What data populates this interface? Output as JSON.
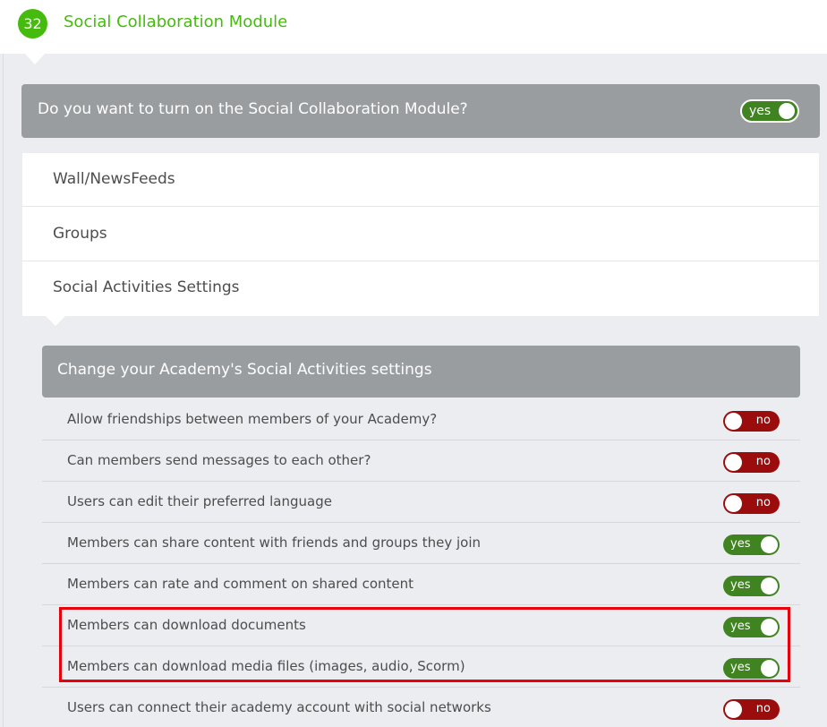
{
  "colors": {
    "accent_green": "#45bb0d",
    "toggle_on": "#3f8421",
    "toggle_off": "#9b0d0d",
    "header_bar_gray": "#9a9da0",
    "highlight_red": "#e8000b"
  },
  "header": {
    "step_number": "32",
    "title": "Social Collaboration Module"
  },
  "question": {
    "text": "Do you want to turn on the Social Collaboration Module?",
    "toggle_label": "yes",
    "toggle_state": "on"
  },
  "tabs": [
    {
      "label": "Wall/NewsFeeds"
    },
    {
      "label": "Groups"
    },
    {
      "label": "Social Activities Settings"
    }
  ],
  "settings": {
    "header": "Change your Academy's Social Activities settings",
    "items": [
      {
        "label": "Allow friendships between members of your Academy?",
        "toggle_label": "no",
        "state": "off"
      },
      {
        "label": "Can members send messages to each other?",
        "toggle_label": "no",
        "state": "off"
      },
      {
        "label": "Users can edit their preferred language",
        "toggle_label": "no",
        "state": "off"
      },
      {
        "label": "Members can share content with friends and groups they join",
        "toggle_label": "yes",
        "state": "on"
      },
      {
        "label": "Members can rate and comment on shared content",
        "toggle_label": "yes",
        "state": "on"
      },
      {
        "label": "Members can download documents",
        "toggle_label": "yes",
        "state": "on"
      },
      {
        "label": "Members can download media files (images, audio, Scorm)",
        "toggle_label": "yes",
        "state": "on"
      },
      {
        "label": "Users can connect their academy account with social networks",
        "toggle_label": "no",
        "state": "off"
      }
    ]
  }
}
